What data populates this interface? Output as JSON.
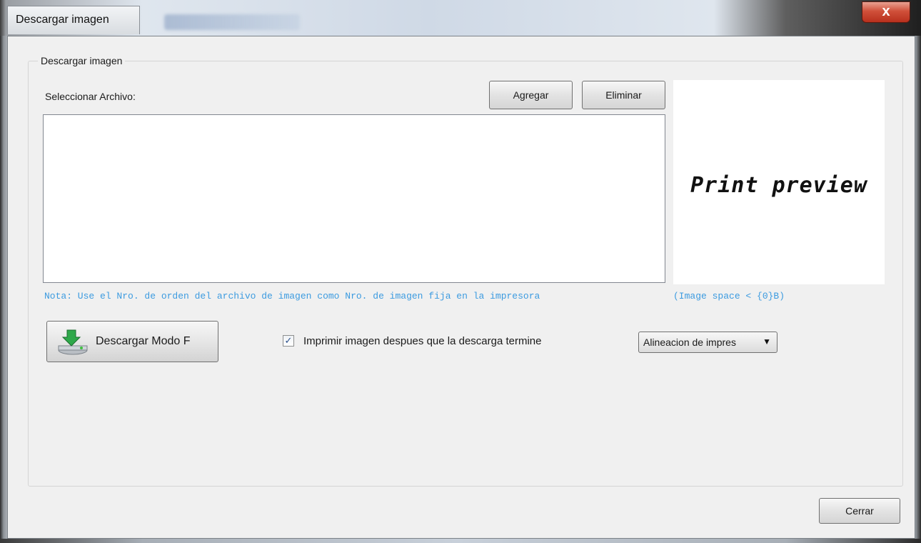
{
  "window": {
    "title": "Descargar imagen",
    "close_symbol": "x"
  },
  "group": {
    "legend": "Descargar imagen"
  },
  "file_section": {
    "label": "Seleccionar Archivo:",
    "add_button": "Agregar",
    "remove_button": "Eliminar"
  },
  "preview": {
    "text": "Print preview"
  },
  "note": {
    "text": "Nota: Use el Nro. de orden del archivo de imagen como Nro. de imagen fija en la impresora",
    "space": "(Image space < {0}B)"
  },
  "actions": {
    "download_button": "Descargar Modo F",
    "download_icon": "download-drive-icon",
    "print_checkbox_label": "Imprimir imagen despues que la descarga termine",
    "print_checkbox_checked": true,
    "alignment_selected": "Alineacion de impres",
    "close_button": "Cerrar"
  },
  "colors": {
    "note_text": "#3c9be0",
    "close_button": "#c8412b"
  }
}
